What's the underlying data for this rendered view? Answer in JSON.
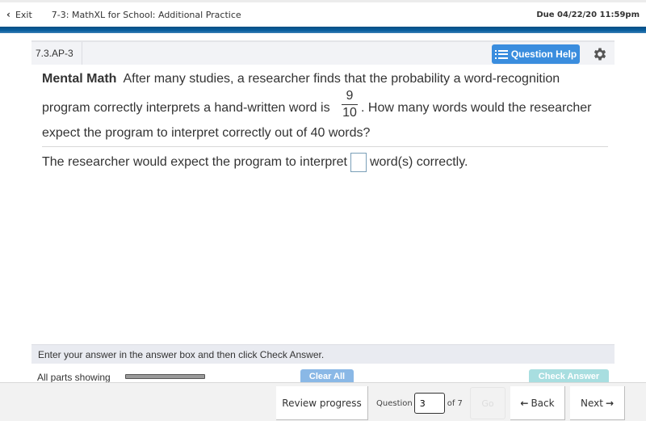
{
  "topbar": {
    "exit_label": "Exit",
    "title": "7-3: MathXL for School: Additional Practice",
    "due": "Due 04/22/20 11:59pm"
  },
  "question_header": {
    "id": "7.3.AP-3",
    "help_label": "Question Help"
  },
  "question": {
    "bold_lead": "Mental Math",
    "line1_rest": "After many studies, a researcher finds that the probability a word-recognition",
    "line2_before": "program correctly interprets a hand-written word is",
    "fraction_numerator": "9",
    "fraction_denominator": "10",
    "line2_after": ". How many words would the researcher",
    "line3": "expect the program to interpret correctly out of 40 words?"
  },
  "answer": {
    "before": "The researcher would expect the program to interpret",
    "value": "",
    "after": "word(s) correctly."
  },
  "instructions": "Enter your answer in the answer box and then click Check Answer.",
  "parts": {
    "label": "All parts showing",
    "clear_all": "Clear All",
    "check_answer": "Check Answer"
  },
  "bottom_nav": {
    "review_progress": "Review progress",
    "question_label": "Question",
    "question_number": "3",
    "of_label": "of 7",
    "go_label": "Go",
    "back_label": "Back",
    "next_label": "Next"
  },
  "colors": {
    "brand_bar": "#064f82",
    "help_button": "#3a8dde",
    "clear_all": "#8ab8e6",
    "check_answer": "#a8dee0"
  }
}
